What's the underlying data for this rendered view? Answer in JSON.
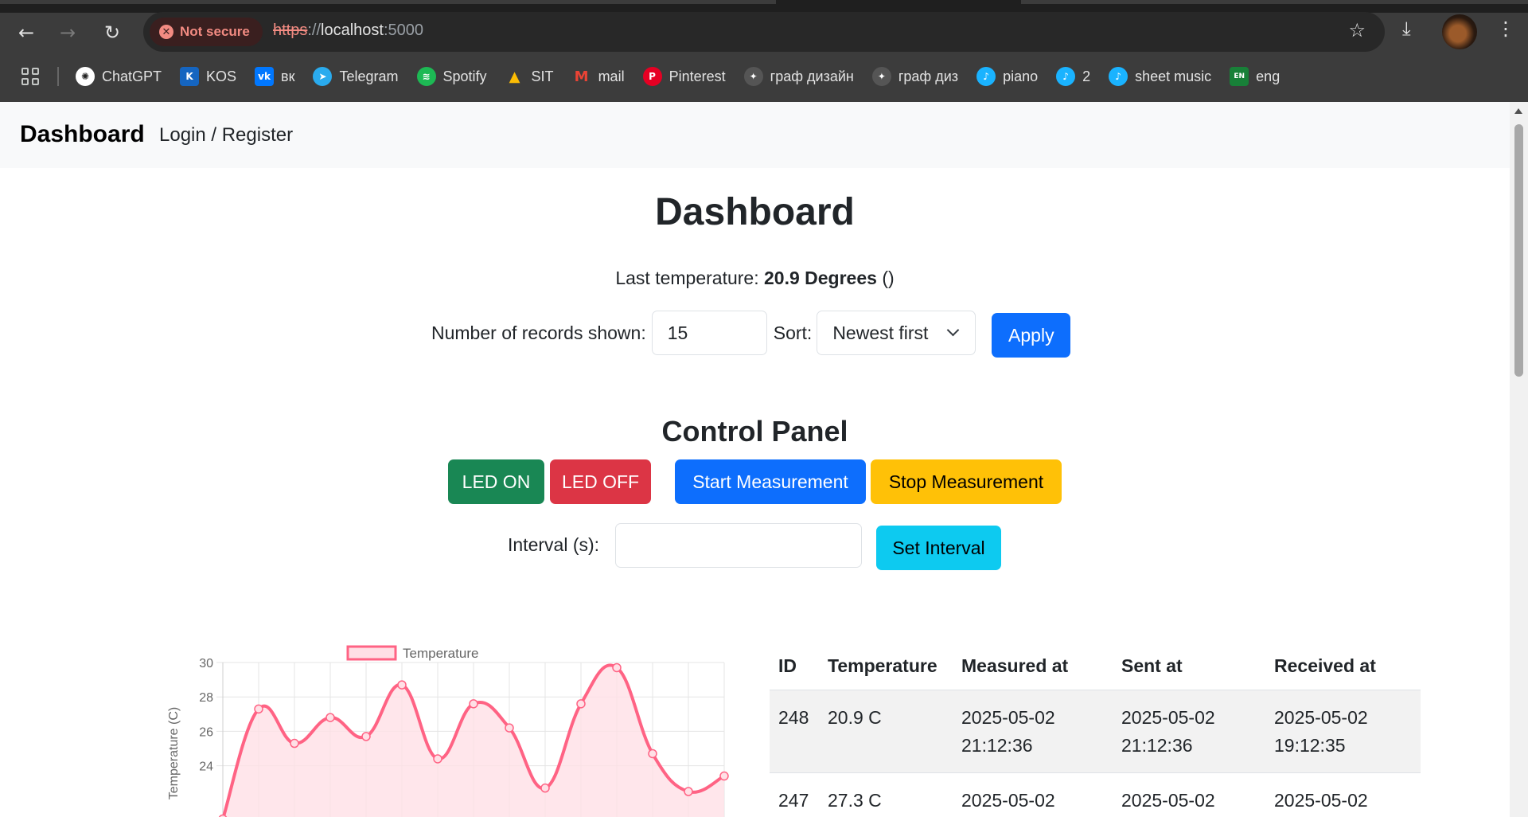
{
  "browser": {
    "security_chip": "Not secure",
    "url_scheme": "https",
    "url_sep": "://",
    "url_host": "localhost",
    "url_port": ":5000",
    "bookmarks": [
      {
        "label": "ChatGPT",
        "icon": "chatgpt-icon",
        "color": "#ffffff"
      },
      {
        "label": "KOS",
        "icon": "kos-icon",
        "color": "#1565c0"
      },
      {
        "label": "вк",
        "icon": "vk-icon",
        "color": "#0077ff"
      },
      {
        "label": "Telegram",
        "icon": "telegram-icon",
        "color": "#2aabee"
      },
      {
        "label": "Spotify",
        "icon": "spotify-icon",
        "color": "#1db954"
      },
      {
        "label": "SIT",
        "icon": "google-drive-icon",
        "color": "#fbbc04"
      },
      {
        "label": "mail",
        "icon": "gmail-icon",
        "color": "#ea4335"
      },
      {
        "label": "Pinterest",
        "icon": "pinterest-icon",
        "color": "#e60023"
      },
      {
        "label": "граф дизайн",
        "icon": "design-icon",
        "color": "#555555"
      },
      {
        "label": "граф диз",
        "icon": "design-icon",
        "color": "#555555"
      },
      {
        "label": "piano",
        "icon": "musescore-icon",
        "color": "#1ab3ff"
      },
      {
        "label": "2",
        "icon": "musescore-icon",
        "color": "#1ab3ff"
      },
      {
        "label": "sheet music",
        "icon": "musescore-icon",
        "color": "#1ab3ff"
      },
      {
        "label": "eng",
        "icon": "translate-icon",
        "color": "#188038"
      }
    ]
  },
  "nav": {
    "brand": "Dashboard",
    "link": "Login / Register"
  },
  "main": {
    "title": "Dashboard",
    "last_temp_label": "Last temperature:",
    "last_temp_value": "20.9 Degrees",
    "last_temp_suffix": "()",
    "records_label": "Number of records shown:",
    "records_value": "15",
    "sort_label": "Sort:",
    "sort_value": "Newest first",
    "apply_label": "Apply"
  },
  "control": {
    "title": "Control Panel",
    "led_on": "LED ON",
    "led_off": "LED OFF",
    "start": "Start Measurement",
    "stop": "Stop Measurement",
    "interval_label": "Interval (s):",
    "interval_value": "",
    "set_interval": "Set Interval"
  },
  "colors": {
    "primary": "#0d6efd",
    "success": "#198754",
    "danger": "#dc3545",
    "warning": "#ffc107",
    "info": "#0dcaf0",
    "chart_line": "#ff6384",
    "chart_fill": "#ffe0e6"
  },
  "chart_data": {
    "type": "line",
    "title": "",
    "legend": [
      "Temperature"
    ],
    "legend_position": "top",
    "ylabel": "Temperature (C)",
    "ylim": [
      22,
      30
    ],
    "yticks": [
      24,
      26,
      28,
      30
    ],
    "grid": true,
    "series": [
      {
        "name": "Temperature",
        "values": [
          20.9,
          27.3,
          25.3,
          26.8,
          25.7,
          28.7,
          24.4,
          27.6,
          26.2,
          22.7,
          27.6,
          29.7,
          24.7,
          22.5,
          23.4
        ],
        "fill": true
      }
    ]
  },
  "table": {
    "headers": [
      "ID",
      "Temperature",
      "Measured at",
      "Sent at",
      "Received at"
    ],
    "rows": [
      {
        "id": "248",
        "temp": "20.9 C",
        "measured_date": "2025-05-02",
        "measured_time": "21:12:36",
        "sent_date": "2025-05-02",
        "sent_time": "21:12:36",
        "received_date": "2025-05-02",
        "received_time": "19:12:35"
      },
      {
        "id": "247",
        "temp": "27.3 C",
        "measured_date": "2025-05-02",
        "measured_time": "",
        "sent_date": "2025-05-02",
        "sent_time": "",
        "received_date": "2025-05-02",
        "received_time": ""
      }
    ]
  }
}
